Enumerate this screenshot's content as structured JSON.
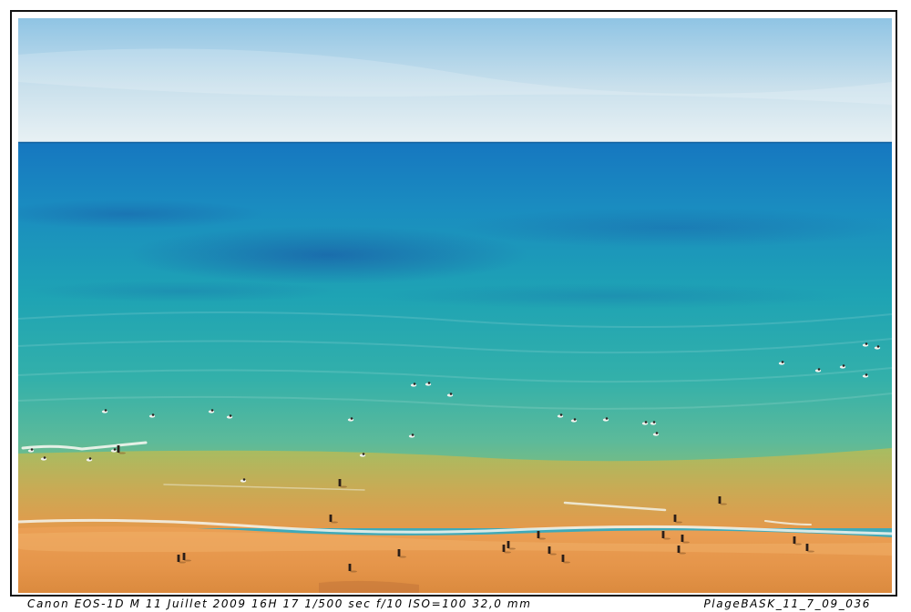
{
  "photo": {
    "subject": "beach-and-ocean-photograph"
  },
  "caption": {
    "left": "Canon EOS-1D M  11 Juillet 2009  16H 17  1/500 sec f/10  ISO=100  32,0 mm",
    "right": "PlageBASK_11_7_09_036"
  },
  "colors": {
    "sky_top": "#8fc4e4",
    "sky_bottom": "#e8f1f4",
    "sea_far": "#1677c0",
    "sea_mid": "#1e9fb2",
    "sea_near": "#49b7a6",
    "shallow": "#9fbe63",
    "sand": "#e79a4a",
    "sand_dark": "#d9833a"
  }
}
